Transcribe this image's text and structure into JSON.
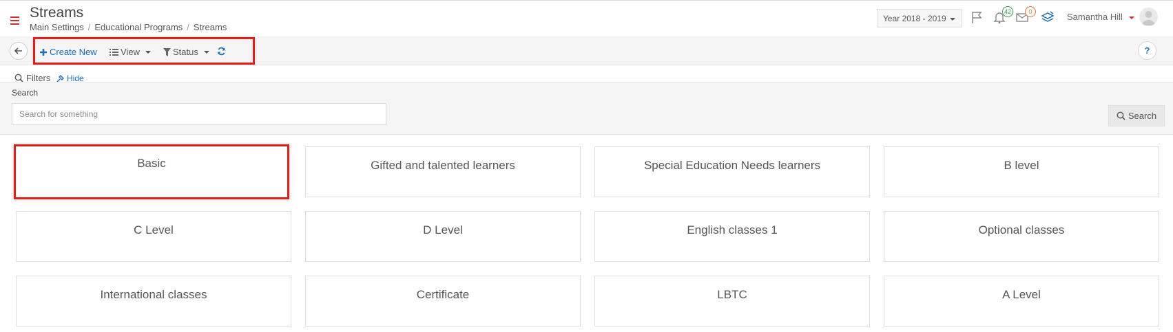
{
  "header": {
    "title": "Streams",
    "breadcrumb": [
      "Main Settings",
      "Educational Programs",
      "Streams"
    ],
    "year_select": "Year 2018 - 2019",
    "notifications_count": "42",
    "messages_count": "0",
    "user_name": "Samantha Hill"
  },
  "toolbar": {
    "create_label": "Create New",
    "view_label": "View",
    "status_label": "Status",
    "help_label": "?"
  },
  "filters": {
    "label": "Filters",
    "hide_label": "Hide",
    "search_label": "Search",
    "search_placeholder": "Search for something",
    "search_button": "Search"
  },
  "streams": [
    "Basic",
    "Gifted and talented learners",
    "Special Education Needs learners",
    "B level",
    "C Level",
    "D Level",
    "English classes 1",
    "Optional classes",
    "International classes",
    "Certificate",
    "LBTC",
    "A Level"
  ],
  "colors": {
    "accent": "#1f6fb2",
    "highlight": "#d9221c",
    "notif_badge": "#3d9b4a",
    "msg_badge": "#e8763b"
  }
}
